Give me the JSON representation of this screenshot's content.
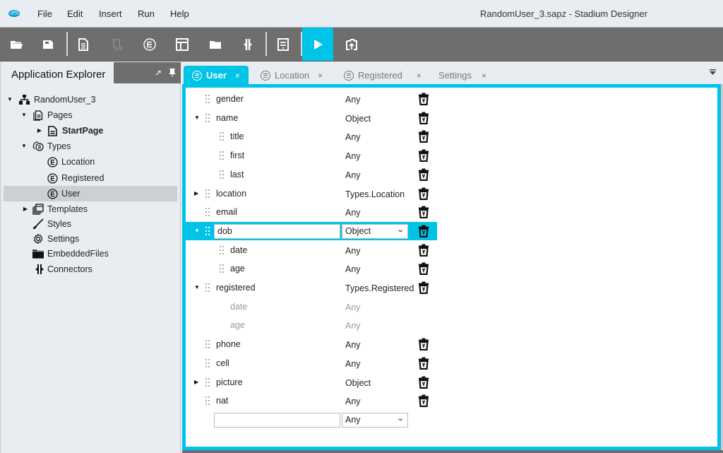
{
  "window": {
    "title": "RandomUser_3.sapz - Stadium Designer"
  },
  "menu": {
    "items": [
      "File",
      "Edit",
      "Insert",
      "Run",
      "Help"
    ]
  },
  "toolbar": {
    "buttons": [
      {
        "name": "open-icon",
        "enabled": true
      },
      {
        "name": "save-icon",
        "enabled": true
      },
      {
        "name": "add-page-icon",
        "enabled": true
      },
      {
        "name": "add-script-icon",
        "enabled": false
      },
      {
        "name": "add-type-icon",
        "enabled": true
      },
      {
        "name": "add-template-icon",
        "enabled": true
      },
      {
        "name": "add-folder-icon",
        "enabled": true
      },
      {
        "name": "add-connector-icon",
        "enabled": true
      },
      {
        "name": "settings-page-icon",
        "enabled": true
      },
      {
        "name": "run-icon",
        "enabled": true,
        "active": true
      },
      {
        "name": "publish-icon",
        "enabled": true
      }
    ],
    "accent_color": "#00c3e8"
  },
  "explorer": {
    "title": "Application Explorer",
    "tree": [
      {
        "label": "RandomUser_3",
        "icon": "sitemap-icon",
        "level": 0,
        "caret": "down"
      },
      {
        "label": "Pages",
        "icon": "pages-icon",
        "level": 1,
        "caret": "down"
      },
      {
        "label": "StartPage",
        "icon": "page-icon",
        "level": 2,
        "caret": "right",
        "bold": true
      },
      {
        "label": "Types",
        "icon": "types-icon",
        "level": 1,
        "caret": "down"
      },
      {
        "label": "Location",
        "icon": "type-icon",
        "level": 2
      },
      {
        "label": "Registered",
        "icon": "type-icon",
        "level": 2
      },
      {
        "label": "User",
        "icon": "type-icon",
        "level": 2,
        "selected": true
      },
      {
        "label": "Templates",
        "icon": "templates-icon",
        "level": 1,
        "caret": "right"
      },
      {
        "label": "Styles",
        "icon": "brush-icon",
        "level": 1
      },
      {
        "label": "Settings",
        "icon": "gear-icon",
        "level": 1
      },
      {
        "label": "EmbeddedFiles",
        "icon": "folder-icon",
        "level": 1
      },
      {
        "label": "Connectors",
        "icon": "connector-icon",
        "level": 1
      }
    ]
  },
  "tabs": [
    {
      "label": "User",
      "active": true,
      "has_icon": true
    },
    {
      "label": "Location",
      "active": false,
      "has_icon": true
    },
    {
      "label": "Registered",
      "active": false,
      "has_icon": true
    },
    {
      "label": "Settings",
      "active": false,
      "has_icon": false
    }
  ],
  "tab_close_glyph": "×",
  "properties": [
    {
      "name": "gender",
      "type": "Any",
      "level": 0
    },
    {
      "name": "name",
      "type": "Object",
      "level": 0,
      "caret": "down"
    },
    {
      "name": "title",
      "type": "Any",
      "level": 1
    },
    {
      "name": "first",
      "type": "Any",
      "level": 1
    },
    {
      "name": "last",
      "type": "Any",
      "level": 1
    },
    {
      "name": "location",
      "type": "Types.Location",
      "level": 0,
      "caret": "right"
    },
    {
      "name": "email",
      "type": "Any",
      "level": 0
    },
    {
      "name": "dob",
      "type": "Object",
      "level": 0,
      "caret": "down",
      "editing": true
    },
    {
      "name": "date",
      "type": "Any",
      "level": 1
    },
    {
      "name": "age",
      "type": "Any",
      "level": 1
    },
    {
      "name": "registered",
      "type": "Types.Registered",
      "level": 0,
      "caret": "down"
    },
    {
      "name": "date",
      "type": "Any",
      "level": 1,
      "readonly": true
    },
    {
      "name": "age",
      "type": "Any",
      "level": 1,
      "readonly": true
    },
    {
      "name": "phone",
      "type": "Any",
      "level": 0
    },
    {
      "name": "cell",
      "type": "Any",
      "level": 0
    },
    {
      "name": "picture",
      "type": "Object",
      "level": 0,
      "caret": "right"
    },
    {
      "name": "nat",
      "type": "Any",
      "level": 0
    }
  ],
  "new_property": {
    "name_value": "",
    "type_value": "Any"
  }
}
